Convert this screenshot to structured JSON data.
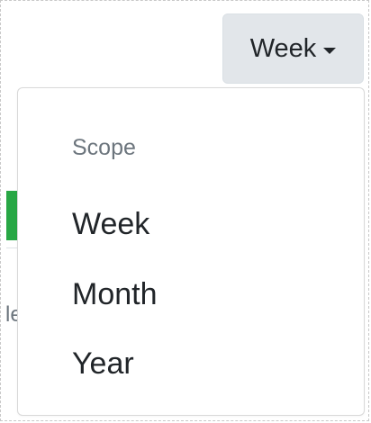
{
  "toggle": {
    "label": "Week"
  },
  "menu": {
    "header": "Scope",
    "items": [
      {
        "label": "Week"
      },
      {
        "label": "Month"
      },
      {
        "label": "Year"
      }
    ]
  },
  "background": {
    "partial_text": "le",
    "accent_color": "#28a745"
  },
  "icons": {
    "caret": "caret-down-icon"
  }
}
